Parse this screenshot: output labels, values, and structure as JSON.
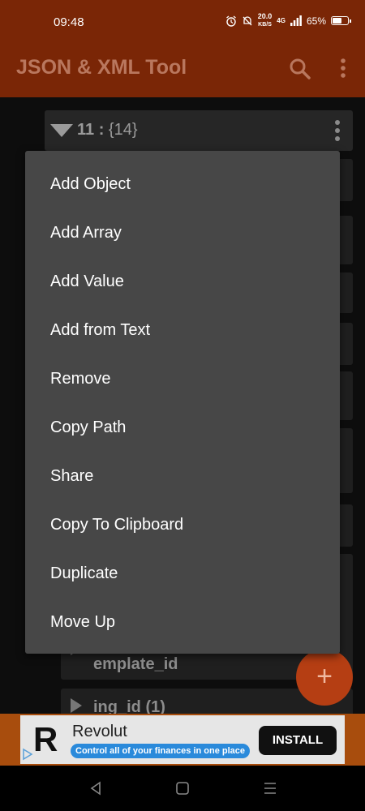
{
  "status_bar": {
    "time": "09:48",
    "net_speed_value": "20.0",
    "net_speed_unit": "KB/S",
    "network": "4G",
    "battery": "65%",
    "battery_level": 0.65
  },
  "app_bar": {
    "title": "JSON & XML Tool",
    "search_icon": "search-icon",
    "overflow_icon": "more-vert-icon"
  },
  "tree": {
    "header": {
      "key": "11 :",
      "value": "{14}"
    },
    "visible_rows": [
      {
        "label": "emplate_id"
      },
      {
        "label": "ing_id (1)"
      }
    ]
  },
  "menu": {
    "items": [
      "Add Object",
      "Add Array",
      "Add Value",
      "Add from Text",
      "Remove",
      "Copy Path",
      "Share",
      "Copy To Clipboard",
      "Duplicate",
      "Move Up"
    ]
  },
  "fab": {
    "label": "+"
  },
  "ad": {
    "logo": "R",
    "title": "Revolut",
    "subtitle": "Control all of your finances in one place",
    "cta": "INSTALL"
  },
  "colors": {
    "primary_dark": "#7a2606",
    "accent": "#b53e13",
    "menu_bg": "#474747"
  }
}
